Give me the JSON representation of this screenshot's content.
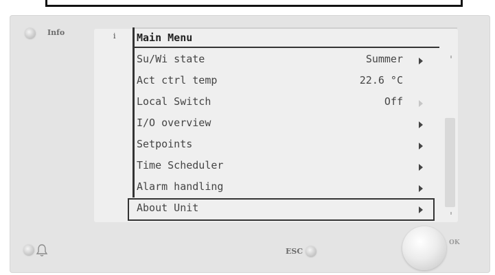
{
  "panel": {
    "info_label": "Info",
    "esc_label": "ESC",
    "ok_label": "OK"
  },
  "screen": {
    "index": "i",
    "title": "Main Menu",
    "items": [
      {
        "label": "Su/Wi state",
        "value": "Summer",
        "arrow": "normal"
      },
      {
        "label": "Act ctrl temp",
        "value": "22.6 °C",
        "arrow": "none"
      },
      {
        "label": "Local Switch",
        "value": "Off",
        "arrow": "dim"
      },
      {
        "label": "I/O overview",
        "value": "",
        "arrow": "normal"
      },
      {
        "label": "Setpoints",
        "value": "",
        "arrow": "normal"
      },
      {
        "label": "Time Scheduler",
        "value": "",
        "arrow": "normal"
      },
      {
        "label": "Alarm handling",
        "value": "",
        "arrow": "normal"
      },
      {
        "label": "About Unit",
        "value": "",
        "arrow": "normal"
      }
    ],
    "selected_index": 7
  },
  "icons": {
    "alarm": "bell-icon",
    "arrow": "triangle-right-icon"
  }
}
